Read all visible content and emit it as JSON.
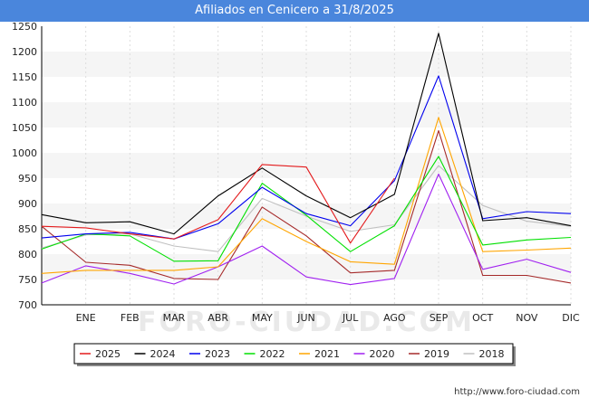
{
  "title": "Afiliados en Cenicero a 31/8/2025",
  "credit": "http://www.foro-ciudad.com",
  "watermark": "FORO-CIUDAD.COM",
  "chart_data": {
    "type": "line",
    "title": "Afiliados en Cenicero a 31/8/2025",
    "xlabel": "",
    "ylabel": "",
    "ylim": [
      700,
      1250
    ],
    "yticks": [
      700,
      750,
      800,
      850,
      900,
      950,
      1000,
      1050,
      1100,
      1150,
      1200,
      1250
    ],
    "categories": [
      "",
      "ENE",
      "FEB",
      "MAR",
      "ABR",
      "MAY",
      "JUN",
      "JUL",
      "AGO",
      "SEP",
      "OCT",
      "NOV",
      "DIC"
    ],
    "grid": "horizontal bands",
    "legend_position": "bottom",
    "series": [
      {
        "name": "2025",
        "color": "#e31a1c",
        "values": [
          855,
          852,
          840,
          830,
          868,
          977,
          972,
          822,
          950,
          null,
          null,
          null,
          null
        ]
      },
      {
        "name": "2024",
        "color": "#000000",
        "values": [
          878,
          862,
          864,
          840,
          915,
          970,
          915,
          872,
          918,
          1236,
          866,
          872,
          856
        ]
      },
      {
        "name": "2023",
        "color": "#0000ee",
        "values": [
          832,
          840,
          843,
          830,
          860,
          932,
          880,
          856,
          945,
          1152,
          870,
          884,
          880
        ]
      },
      {
        "name": "2022",
        "color": "#00e000",
        "values": [
          810,
          840,
          836,
          786,
          787,
          940,
          877,
          805,
          856,
          993,
          818,
          828,
          833
        ]
      },
      {
        "name": "2021",
        "color": "#ffa500",
        "values": [
          762,
          768,
          768,
          768,
          775,
          870,
          825,
          785,
          780,
          1070,
          805,
          808,
          812
        ]
      },
      {
        "name": "2020",
        "color": "#a020f0",
        "values": [
          743,
          777,
          762,
          741,
          775,
          816,
          755,
          740,
          752,
          958,
          770,
          790,
          764
        ]
      },
      {
        "name": "2019",
        "color": "#a52a2a",
        "values": [
          855,
          784,
          778,
          752,
          750,
          893,
          836,
          763,
          768,
          1044,
          758,
          758,
          743
        ]
      },
      {
        "name": "2018",
        "color": "#c0c0c0",
        "values": [
          812,
          838,
          840,
          816,
          805,
          910,
          875,
          845,
          858,
          975,
          896,
          865,
          855
        ]
      }
    ]
  }
}
